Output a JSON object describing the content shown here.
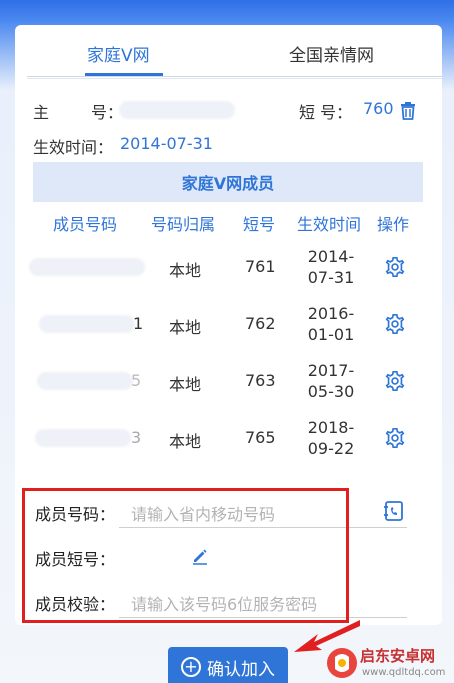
{
  "tabs": [
    {
      "label": "家庭V网",
      "active": true
    },
    {
      "label": "全国亲情网",
      "active": false
    }
  ],
  "main_number": {
    "label": "主",
    "label2": "号：",
    "short_label": "短 号：",
    "short_value": "760"
  },
  "effective": {
    "label": "生效时间：",
    "value": "2014-07-31"
  },
  "members": {
    "title": "家庭V网成员",
    "headers": [
      "成员号码",
      "号码归属",
      "短号",
      "生效时间",
      "操作"
    ],
    "rows": [
      {
        "number_suffix": "",
        "location": "本地",
        "short": "761",
        "date1": "2014-",
        "date2": "07-31"
      },
      {
        "number_suffix": "1",
        "location": "本地",
        "short": "762",
        "date1": "2016-",
        "date2": "01-01"
      },
      {
        "number_suffix": "5",
        "location": "本地",
        "short": "763",
        "date1": "2017-",
        "date2": "05-30"
      },
      {
        "number_suffix": "3",
        "location": "本地",
        "short": "765",
        "date1": "2018-",
        "date2": "09-22"
      }
    ]
  },
  "form": {
    "number_label": "成员号码：",
    "number_placeholder": "请输入省内移动号码",
    "short_label": "成员短号：",
    "verify_label": "成员校验：",
    "verify_placeholder": "请输入该号码6位服务密码"
  },
  "confirm_button": {
    "label": "确认加入"
  },
  "watermark": {
    "line1": "启东安卓网",
    "line2": "www.qdltdq.com"
  },
  "colors": {
    "accent": "#2f75d8",
    "highlight": "#e02020"
  },
  "icons": [
    "trash-icon",
    "gear-icon",
    "contact-book-icon",
    "pencil-icon",
    "plus-circle-icon"
  ]
}
